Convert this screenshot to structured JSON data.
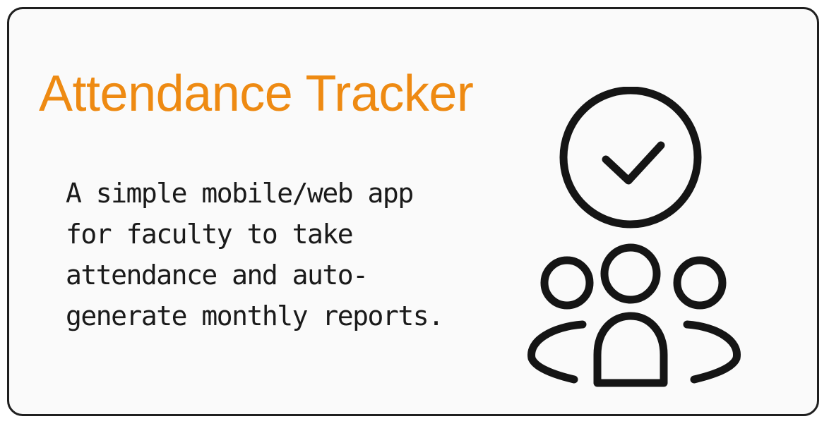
{
  "card": {
    "title": "Attendance Tracker",
    "title_color": "#ee8a12",
    "description_lines": [
      "A simple mobile/web app",
      "for faculty to take",
      "attendance and auto-",
      "generate monthly reports."
    ],
    "illustration": {
      "icons": [
        "check-circle-icon",
        "group-people-icon"
      ],
      "stroke_color": "#151515"
    }
  }
}
